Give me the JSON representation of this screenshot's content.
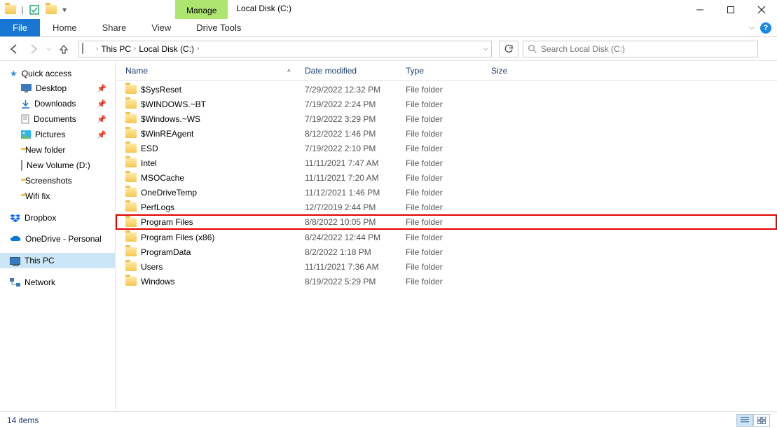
{
  "titlebar": {
    "context_tab": "Manage",
    "title": "Local Disk (C:)"
  },
  "ribbon": {
    "file": "File",
    "home": "Home",
    "share": "Share",
    "view": "View",
    "drive_tools": "Drive Tools"
  },
  "address": {
    "seg1": "This PC",
    "seg2": "Local Disk (C:)"
  },
  "search": {
    "placeholder": "Search Local Disk (C:)"
  },
  "sidebar": {
    "quick_access": "Quick access",
    "items": [
      {
        "label": "Desktop",
        "pinned": true
      },
      {
        "label": "Downloads",
        "pinned": true
      },
      {
        "label": "Documents",
        "pinned": true
      },
      {
        "label": "Pictures",
        "pinned": true
      },
      {
        "label": "New folder",
        "pinned": false
      },
      {
        "label": "New Volume (D:)",
        "pinned": false
      },
      {
        "label": "Screenshots",
        "pinned": false
      },
      {
        "label": "Wifi fix",
        "pinned": false
      }
    ],
    "dropbox": "Dropbox",
    "onedrive": "OneDrive - Personal",
    "thispc": "This PC",
    "network": "Network"
  },
  "columns": {
    "name": "Name",
    "date": "Date modified",
    "type": "Type",
    "size": "Size"
  },
  "files": [
    {
      "name": "$SysReset",
      "date": "7/29/2022 12:32 PM",
      "type": "File folder"
    },
    {
      "name": "$WINDOWS.~BT",
      "date": "7/19/2022 2:24 PM",
      "type": "File folder"
    },
    {
      "name": "$Windows.~WS",
      "date": "7/19/2022 3:29 PM",
      "type": "File folder"
    },
    {
      "name": "$WinREAgent",
      "date": "8/12/2022 1:46 PM",
      "type": "File folder"
    },
    {
      "name": "ESD",
      "date": "7/19/2022 2:10 PM",
      "type": "File folder"
    },
    {
      "name": "Intel",
      "date": "11/11/2021 7:47 AM",
      "type": "File folder"
    },
    {
      "name": "MSOCache",
      "date": "11/11/2021 7:20 AM",
      "type": "File folder"
    },
    {
      "name": "OneDriveTemp",
      "date": "11/12/2021 1:46 PM",
      "type": "File folder"
    },
    {
      "name": "PerfLogs",
      "date": "12/7/2019 2:44 PM",
      "type": "File folder"
    },
    {
      "name": "Program Files",
      "date": "8/8/2022 10:05 PM",
      "type": "File folder",
      "marked": true
    },
    {
      "name": "Program Files (x86)",
      "date": "8/24/2022 12:44 PM",
      "type": "File folder"
    },
    {
      "name": "ProgramData",
      "date": "8/2/2022 1:18 PM",
      "type": "File folder"
    },
    {
      "name": "Users",
      "date": "11/11/2021 7:36 AM",
      "type": "File folder"
    },
    {
      "name": "Windows",
      "date": "8/19/2022 5:29 PM",
      "type": "File folder"
    }
  ],
  "status": {
    "count": "14 items"
  }
}
